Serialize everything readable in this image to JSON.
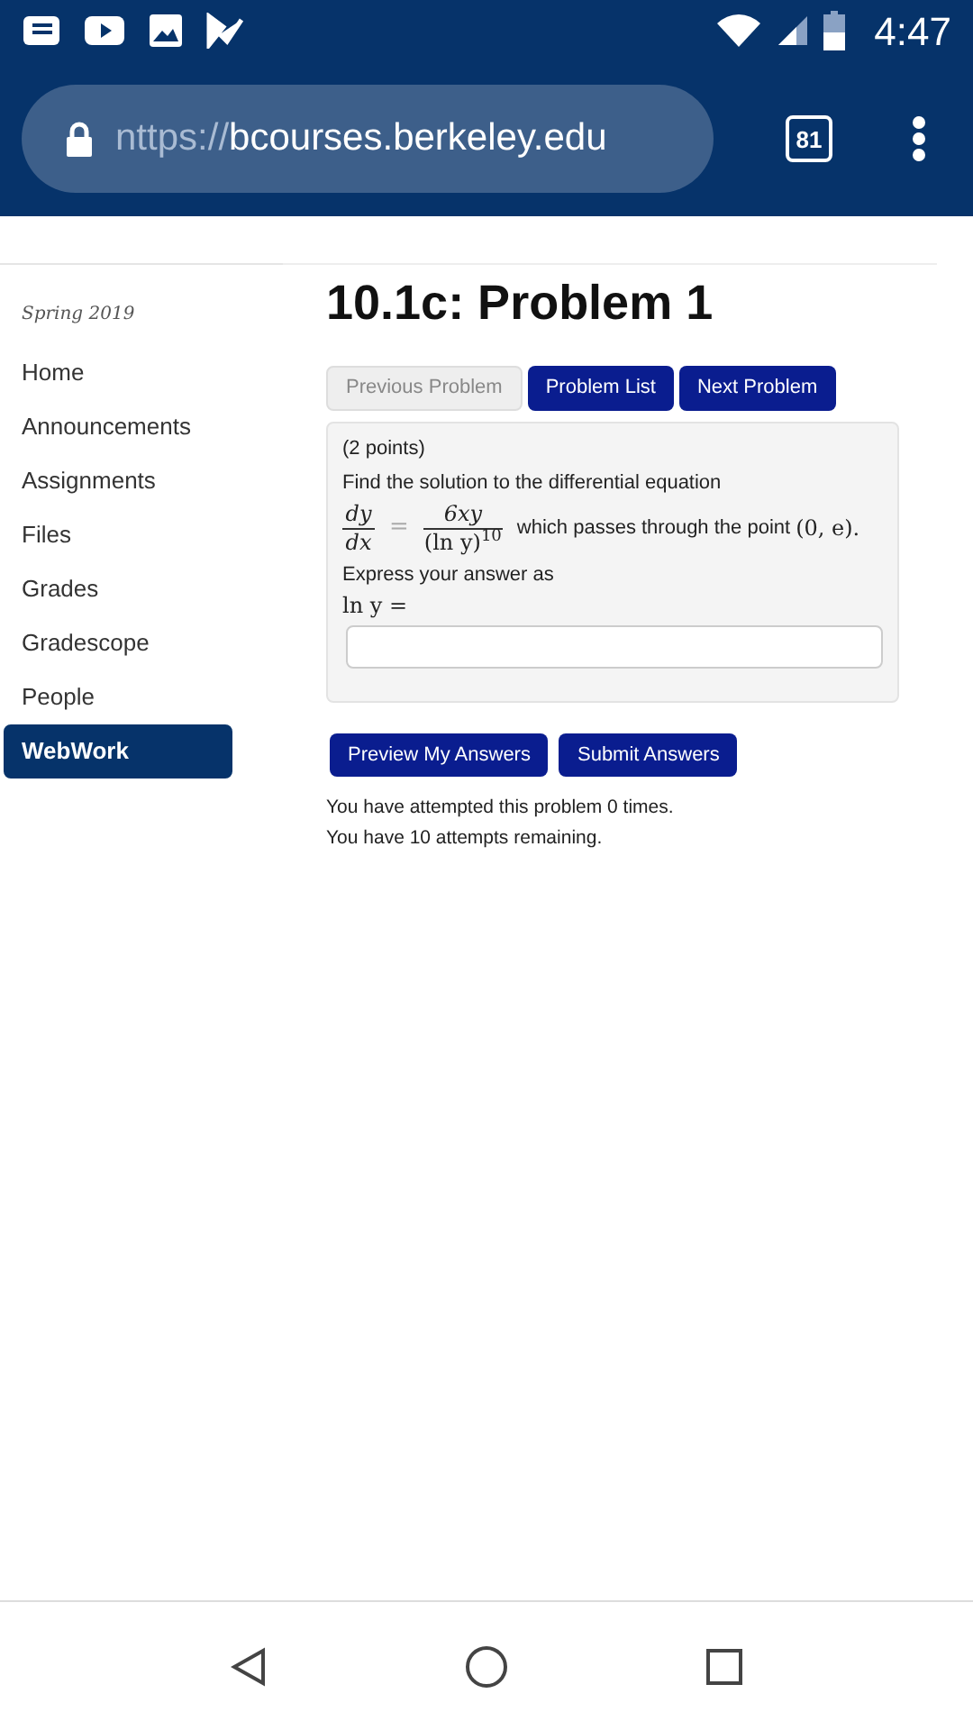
{
  "status_bar": {
    "time": "4:47"
  },
  "browser": {
    "url_scheme": "nttps://",
    "url_host": "bcourses.berkeley.edu",
    "tab_count": "81"
  },
  "sidebar": {
    "term": "Spring 2019",
    "items": [
      {
        "label": "Home",
        "selected": false
      },
      {
        "label": "Announcements",
        "selected": false
      },
      {
        "label": "Assignments",
        "selected": false
      },
      {
        "label": "Files",
        "selected": false
      },
      {
        "label": "Grades",
        "selected": false
      },
      {
        "label": "Gradescope",
        "selected": false
      },
      {
        "label": "People",
        "selected": false
      },
      {
        "label": "WebWork",
        "selected": true
      }
    ]
  },
  "problem": {
    "title": "10.1c: Problem 1",
    "nav_buttons": [
      {
        "label": "Previous Problem",
        "disabled": true
      },
      {
        "label": "Problem List",
        "disabled": false
      },
      {
        "label": "Next Problem",
        "disabled": false
      }
    ],
    "points": "(2 points)",
    "prompt": "Find the solution to the differential equation",
    "equation": {
      "lhs_numerator": "dy",
      "lhs_denominator": "dx",
      "equals": "=",
      "rhs_numerator": "6xy",
      "rhs_denominator": "(ln y)$^{10}$",
      "trailing": "which passes through the point",
      "point": "(0, e)."
    },
    "instruction": "Express your answer as",
    "answer_label": "ln y =",
    "actions": [
      "Preview My Answers",
      "Submit Answers"
    ],
    "messages": [
      "You have attempted this problem 0 times.",
      "You have 10 attempts remaining."
    ]
  }
}
